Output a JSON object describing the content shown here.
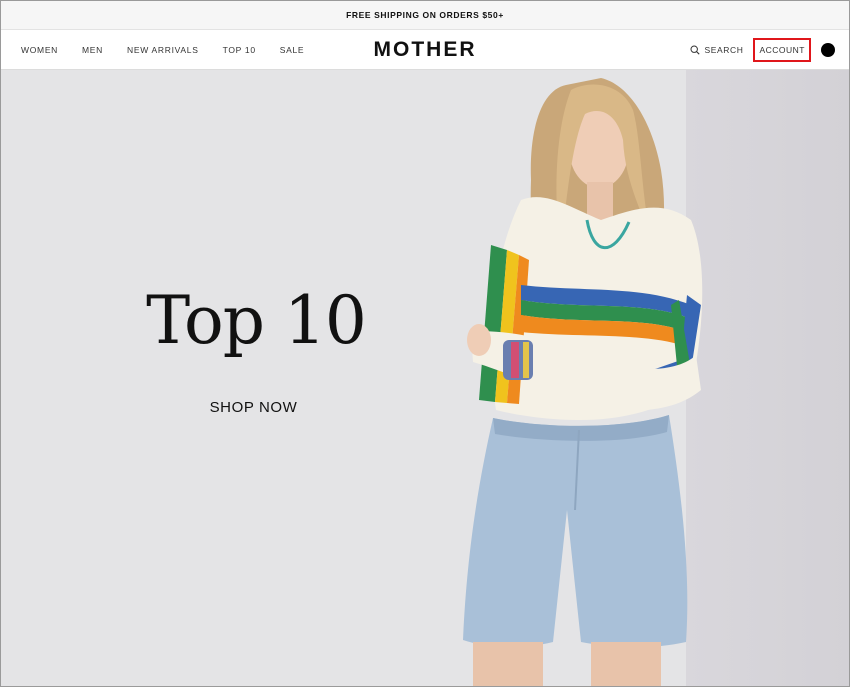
{
  "promo": {
    "text": "FREE SHIPPING ON ORDERS $50+"
  },
  "nav": {
    "links": [
      "WOMEN",
      "MEN",
      "NEW ARRIVALS",
      "TOP 10",
      "SALE"
    ],
    "logo": "MOTHER",
    "search_label": "SEARCH",
    "account_label": "ACCOUNT",
    "icons": {
      "search": "search-icon",
      "cart": "cart-icon"
    }
  },
  "hero": {
    "title": "Top 10",
    "cta": "SHOP NOW",
    "image": "woman-rainbow-tee-denim-shorts"
  },
  "colors": {
    "highlight": "#e0161b",
    "hero_bg": "#e4e4e6"
  }
}
